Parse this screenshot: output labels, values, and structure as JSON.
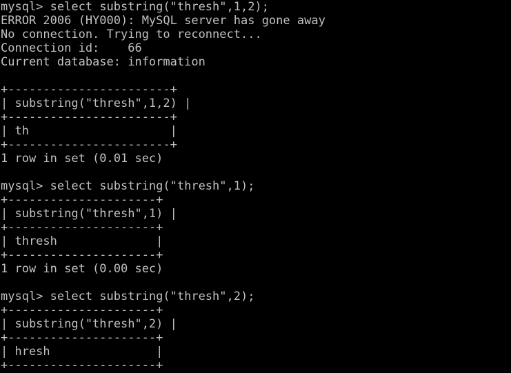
{
  "terminal": {
    "lines": [
      "mysql> select substring(\"thresh\",1,2);",
      "ERROR 2006 (HY000): MySQL server has gone away",
      "No connection. Trying to reconnect...",
      "Connection id:    66",
      "Current database: information",
      "",
      "+-----------------------+",
      "| substring(\"thresh\",1,2) |",
      "+-----------------------+",
      "| th                    |",
      "+-----------------------+",
      "1 row in set (0.01 sec)",
      "",
      "mysql> select substring(\"thresh\",1);",
      "+---------------------+",
      "| substring(\"thresh\",1) |",
      "+---------------------+",
      "| thresh              |",
      "+---------------------+",
      "1 row in set (0.00 sec)",
      "",
      "mysql> select substring(\"thresh\",2);",
      "+---------------------+",
      "| substring(\"thresh\",2) |",
      "+---------------------+",
      "| hresh               |",
      "+---------------------+"
    ]
  },
  "colors": {
    "background": "#000000",
    "text": "#c0c0c0"
  }
}
